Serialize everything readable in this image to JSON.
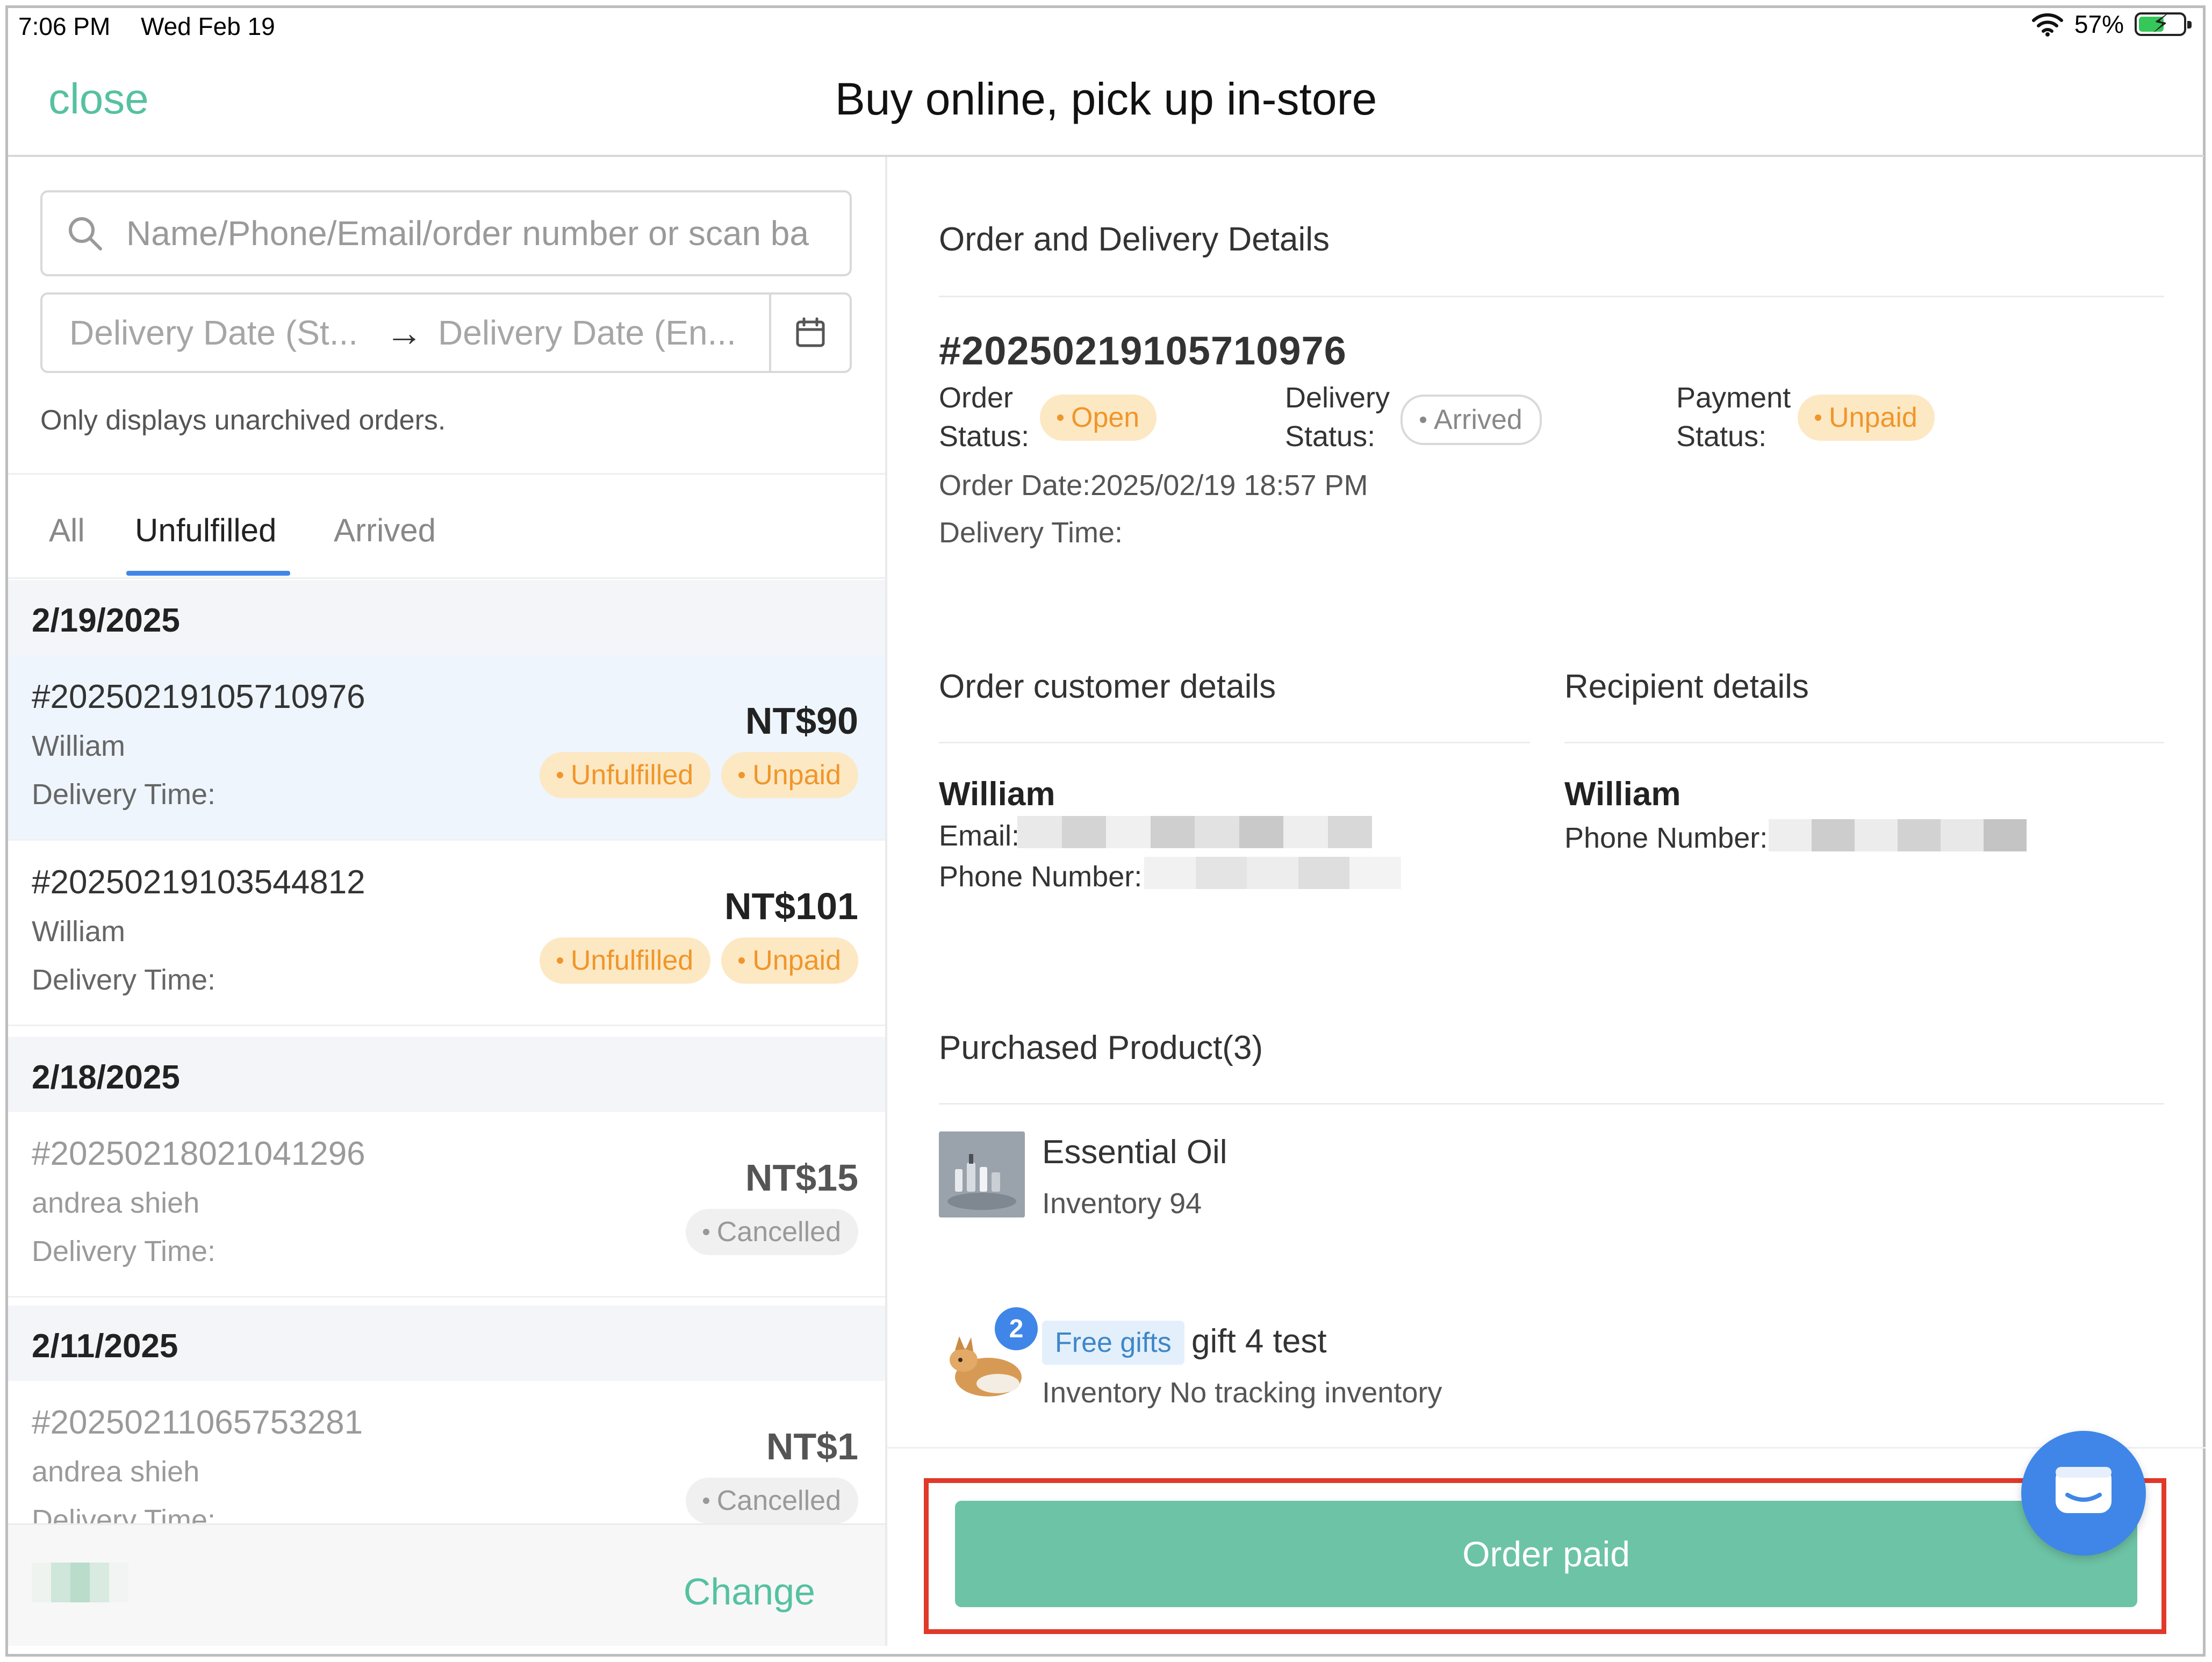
{
  "status_bar": {
    "time": "7:06 PM",
    "date": "Wed Feb 19",
    "battery": "57%",
    "battery_level": 0.57
  },
  "header": {
    "close_label": "close",
    "title": "Buy online, pick up in-store"
  },
  "filters": {
    "search_placeholder": "Name/Phone/Email/order number or scan ba",
    "date_start_placeholder": "Delivery Date (St...",
    "date_end_placeholder": "Delivery Date (En...",
    "hint": "Only displays unarchived orders."
  },
  "tabs": [
    {
      "label": "All",
      "active": false
    },
    {
      "label": "Unfulfilled",
      "active": true
    },
    {
      "label": "Arrived",
      "active": false
    }
  ],
  "groups": [
    {
      "date": "2/19/2025",
      "orders": [
        {
          "number": "#20250219105710976",
          "customer": "William",
          "delivery_label": "Delivery Time:",
          "price": "NT$90",
          "badges": [
            "Unfulfilled",
            "Unpaid"
          ]
        },
        {
          "number": "#20250219103544812",
          "customer": "William",
          "delivery_label": "Delivery Time:",
          "price": "NT$101",
          "badges": [
            "Unfulfilled",
            "Unpaid"
          ]
        }
      ]
    },
    {
      "date": "2/18/2025",
      "orders": [
        {
          "number": "#20250218021041296",
          "customer": "andrea shieh",
          "delivery_label": "Delivery Time:",
          "price": "NT$15",
          "badges": [
            "Cancelled"
          ]
        }
      ]
    },
    {
      "date": "2/11/2025",
      "orders": [
        {
          "number": "#20250211065753281",
          "customer": "andrea shieh",
          "delivery_label": "Delivery Time:",
          "price": "NT$1",
          "badges": [
            "Cancelled"
          ]
        }
      ]
    }
  ],
  "footer": {
    "change_label": "Change"
  },
  "detail": {
    "section_title": "Order and Delivery Details",
    "order_number": "#20250219105710976",
    "order_status_label": [
      "Order",
      "Status:"
    ],
    "order_status": "Open",
    "delivery_status_label": [
      "Delivery",
      "Status:"
    ],
    "delivery_status": "Arrived",
    "payment_status_label": [
      "Payment",
      "Status:"
    ],
    "payment_status": "Unpaid",
    "order_date": "Order Date:2025/02/19 18:57 PM",
    "delivery_time": "Delivery Time:"
  },
  "customer": {
    "title": "Order customer details",
    "name": "William",
    "email_label": "Email:",
    "phone_label": "Phone Number:"
  },
  "recipient": {
    "title": "Recipient details",
    "name": "William",
    "phone_label": "Phone Number:"
  },
  "products": {
    "title": "Purchased Product(3)",
    "items": [
      {
        "name": "Essential Oil",
        "inventory": "Inventory 94"
      },
      {
        "tag": "Free gifts",
        "name": "gift 4 test",
        "inventory": "Inventory No tracking inventory",
        "quantity": "2"
      }
    ]
  },
  "action": {
    "pay_label": "Order paid"
  },
  "colors": {
    "accent_green": "#55c1a0",
    "button_green": "#6dc3a5",
    "tab_blue": "#3f86e8",
    "badge_orange": "#f0962a",
    "highlight_red": "#e0392a"
  }
}
